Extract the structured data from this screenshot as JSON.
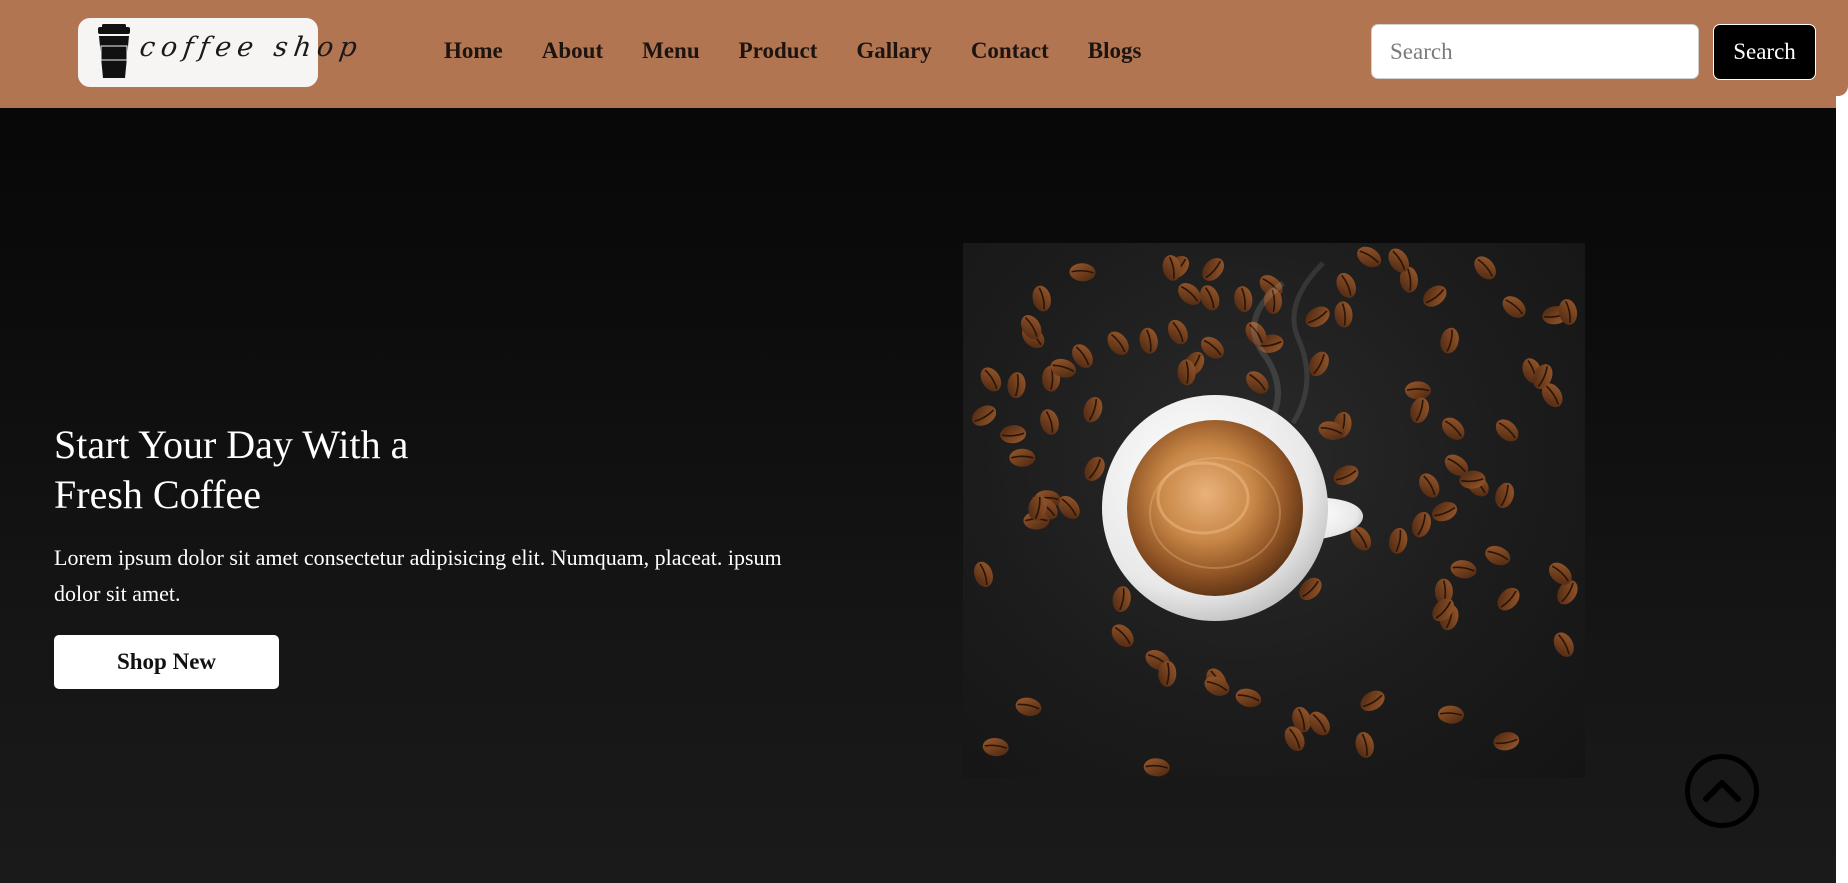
{
  "header": {
    "logo_text": "coffee shop",
    "nav": [
      "Home",
      "About",
      "Menu",
      "Product",
      "Gallary",
      "Contact",
      "Blogs"
    ],
    "search_placeholder": "Search",
    "search_button": "Search"
  },
  "hero": {
    "title_line1": "Start Your Day With a",
    "title_line2": "Fresh Coffee",
    "description": "Lorem ipsum dolor sit amet consectetur adipisicing elit. Numquam, placeat. ipsum dolor sit amet.",
    "cta": "Shop New",
    "image": "coffee-cup-with-beans-photo"
  },
  "icons": {
    "logo": "coffee-cup-icon",
    "scroll_top": "chevron-up-circle-icon"
  },
  "colors": {
    "header_bg": "#b27552",
    "page_bg": "#111111",
    "button_dark": "#000000",
    "button_light": "#ffffff"
  }
}
